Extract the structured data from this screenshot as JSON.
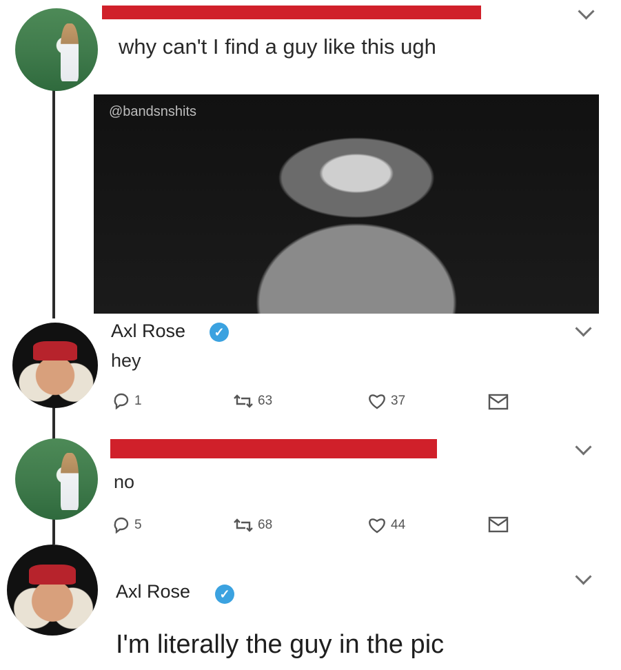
{
  "tweet1": {
    "text": "why can't I find a guy like this ugh"
  },
  "image": {
    "watermark": "@bandsnshits"
  },
  "tweet2": {
    "name": "Axl Rose",
    "text": "hey",
    "actions": {
      "replies": "1",
      "retweets": "63",
      "likes": "37"
    }
  },
  "tweet3": {
    "text": "no",
    "actions": {
      "replies": "5",
      "retweets": "68",
      "likes": "44"
    }
  },
  "tweet4": {
    "name": "Axl Rose",
    "text": "I'm literally the guy in the pic"
  },
  "icons": {
    "chevron": "chevron-down-icon",
    "verified": "verified-badge-icon",
    "reply": "reply-icon",
    "retweet": "retweet-icon",
    "like": "heart-icon",
    "message": "message-icon"
  },
  "colors": {
    "redaction": "#d0202a",
    "verified": "#3ba2e0",
    "thread": "#2b2b2b"
  }
}
